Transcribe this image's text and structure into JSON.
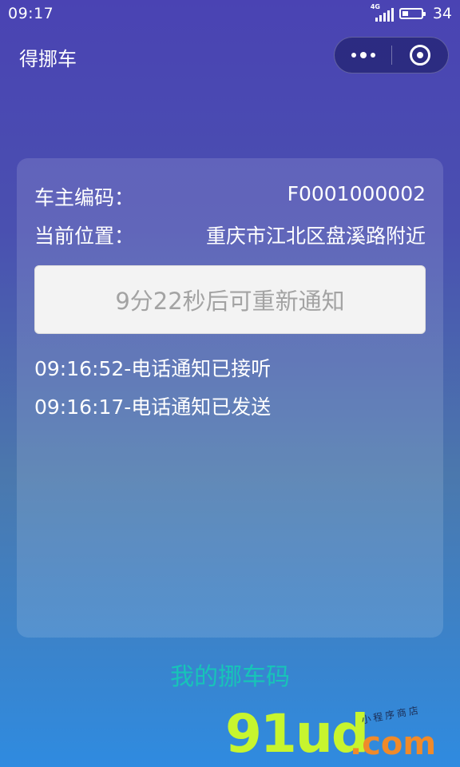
{
  "status_bar": {
    "time": "09:17",
    "network": "4G",
    "battery": "34",
    "battery_level": 0.34
  },
  "nav": {
    "title": "得挪车",
    "more_icon": "more-dots-icon",
    "close_icon": "close-circle-icon"
  },
  "card": {
    "owner_label": "车主编码：",
    "owner_value": "F0001000002",
    "location_label": "当前位置：",
    "location_value": "重庆市江北区盘溪路附近",
    "notify_button": "9分22秒后可重新通知",
    "logs": [
      "09:16:52-电话通知已接听",
      "09:16:17-电话通知已发送"
    ]
  },
  "my_code_link": "我的挪车码",
  "watermark": {
    "main": "91ud",
    "suffix": ".com",
    "tagline": "小程序商店"
  },
  "colors": {
    "link": "#17c4b8",
    "background_top": "#4a43b3",
    "background_bottom": "#2f8be0"
  }
}
